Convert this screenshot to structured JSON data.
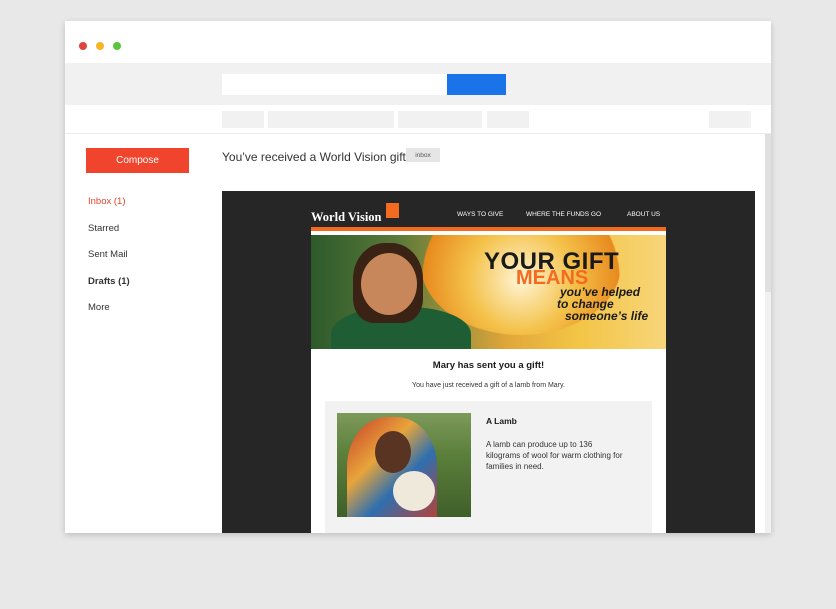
{
  "sidebar": {
    "compose_label": "Compose",
    "items": [
      {
        "label": "Inbox (1)"
      },
      {
        "label": "Starred"
      },
      {
        "label": "Sent Mail"
      },
      {
        "label": "Drafts (1)"
      },
      {
        "label": "More"
      }
    ]
  },
  "message": {
    "subject": "You’ve received a World Vision gift",
    "label_badge": "inbox"
  },
  "email": {
    "logo": "World Vision",
    "nav": [
      "WAYS TO GIVE",
      "WHERE THE FUNDS GO",
      "ABOUT US"
    ],
    "hero": {
      "line1": "YOUR GIFT",
      "line2": "MEANS",
      "line3": "you’ve helped",
      "line4": "to change",
      "line5": "someone’s life"
    },
    "heading": "Mary has sent you a gift!",
    "text": "You have just received a gift of a lamb from Mary.",
    "gift": {
      "title": "A Lamb",
      "description": "A lamb can produce up to 136 kilograms of wool for warm clothing for families in need."
    }
  },
  "colors": {
    "accent": "#f0442c",
    "search_button": "#1a73e8",
    "brand_orange": "#f36b21",
    "frame_dark": "#262626"
  }
}
